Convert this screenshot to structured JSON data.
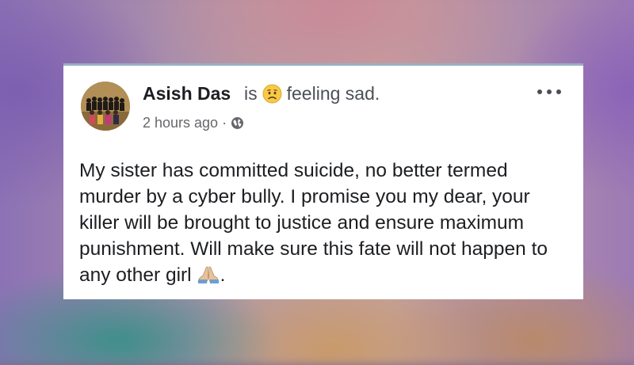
{
  "post": {
    "author_name": "Asish Das",
    "verb": "is",
    "feeling_text": "feeling sad.",
    "feeling_icon": "sad-face-emoji",
    "timestamp": "2 hours ago",
    "separator": "·",
    "privacy_icon": "globe-icon",
    "menu_icon": "more-options-icon",
    "body": "My sister has committed suicide, no better termed murder by a cyber bully. I promise you my dear, your killer will be brought to justice and ensure maximum punishment. Will make sure this fate will not happen to any other girl",
    "body_end_icon": "folded-hands-emoji",
    "body_end_punct": "."
  },
  "colors": {
    "card_background": "#ffffff",
    "text_primary": "#1c1e21",
    "text_secondary": "#65676b"
  }
}
